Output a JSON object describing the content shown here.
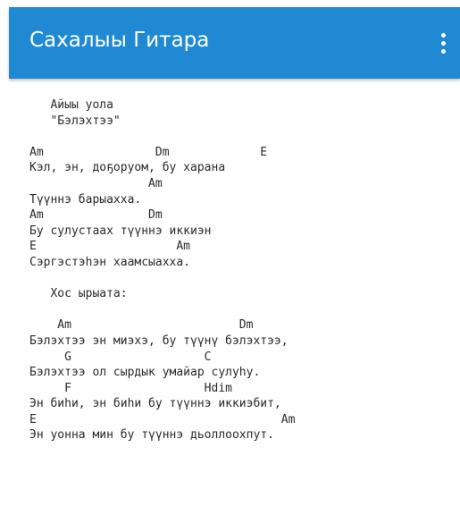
{
  "app": {
    "title": "Сахалыы Гитара",
    "accent_color": "#1f8ad3",
    "menu_icon": "more-vertical-icon"
  },
  "lyrics": {
    "lines": [
      "   Айыы уола",
      "   \"Бэлэхтээ\"",
      "",
      "Am                Dm             E",
      "Кэл, эн, доҕоруом, бу харана",
      "                 Am",
      "Түүннэ барыахха.",
      "Am               Dm",
      "Бу сулустаах түүннэ иккиэн",
      "E                    Am",
      "Сэргэстэһэн хаамсыахха.",
      "",
      "   Хос ырыата:",
      "",
      "    Am                        Dm",
      "Бэлэхтээ эн миэхэ, бу түүнү бэлэхтээ,",
      "     G                   C",
      "Бэлэхтээ ол сырдык умайар сулуһу.",
      "     F                   Hdim",
      "Эн биһи, эн биһи бу түүннэ иккиэбит,",
      "E                                   Am",
      "Эн уонна мин бу түүннэ дьоллоохпут."
    ]
  }
}
